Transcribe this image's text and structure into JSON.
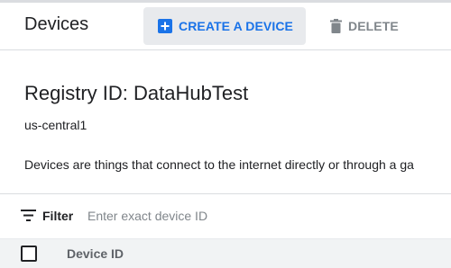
{
  "header": {
    "title": "Devices",
    "create_button": {
      "label": "CREATE A DEVICE",
      "icon": "add-box-icon"
    },
    "delete_button": {
      "label": "DELETE",
      "icon": "trash-icon"
    }
  },
  "registry": {
    "title": "Registry ID: DataHubTest",
    "region": "us-central1",
    "description": "Devices are things that connect to the internet directly or through a ga"
  },
  "filter": {
    "label": "Filter",
    "icon": "filter-list-icon",
    "placeholder": "Enter exact device ID"
  },
  "table": {
    "columns": [
      "Device ID"
    ]
  },
  "colors": {
    "accent": "#1a73e8",
    "button_bg": "#e8eaed",
    "header_row_bg": "#f1f3f4",
    "muted_text": "#80868b"
  }
}
